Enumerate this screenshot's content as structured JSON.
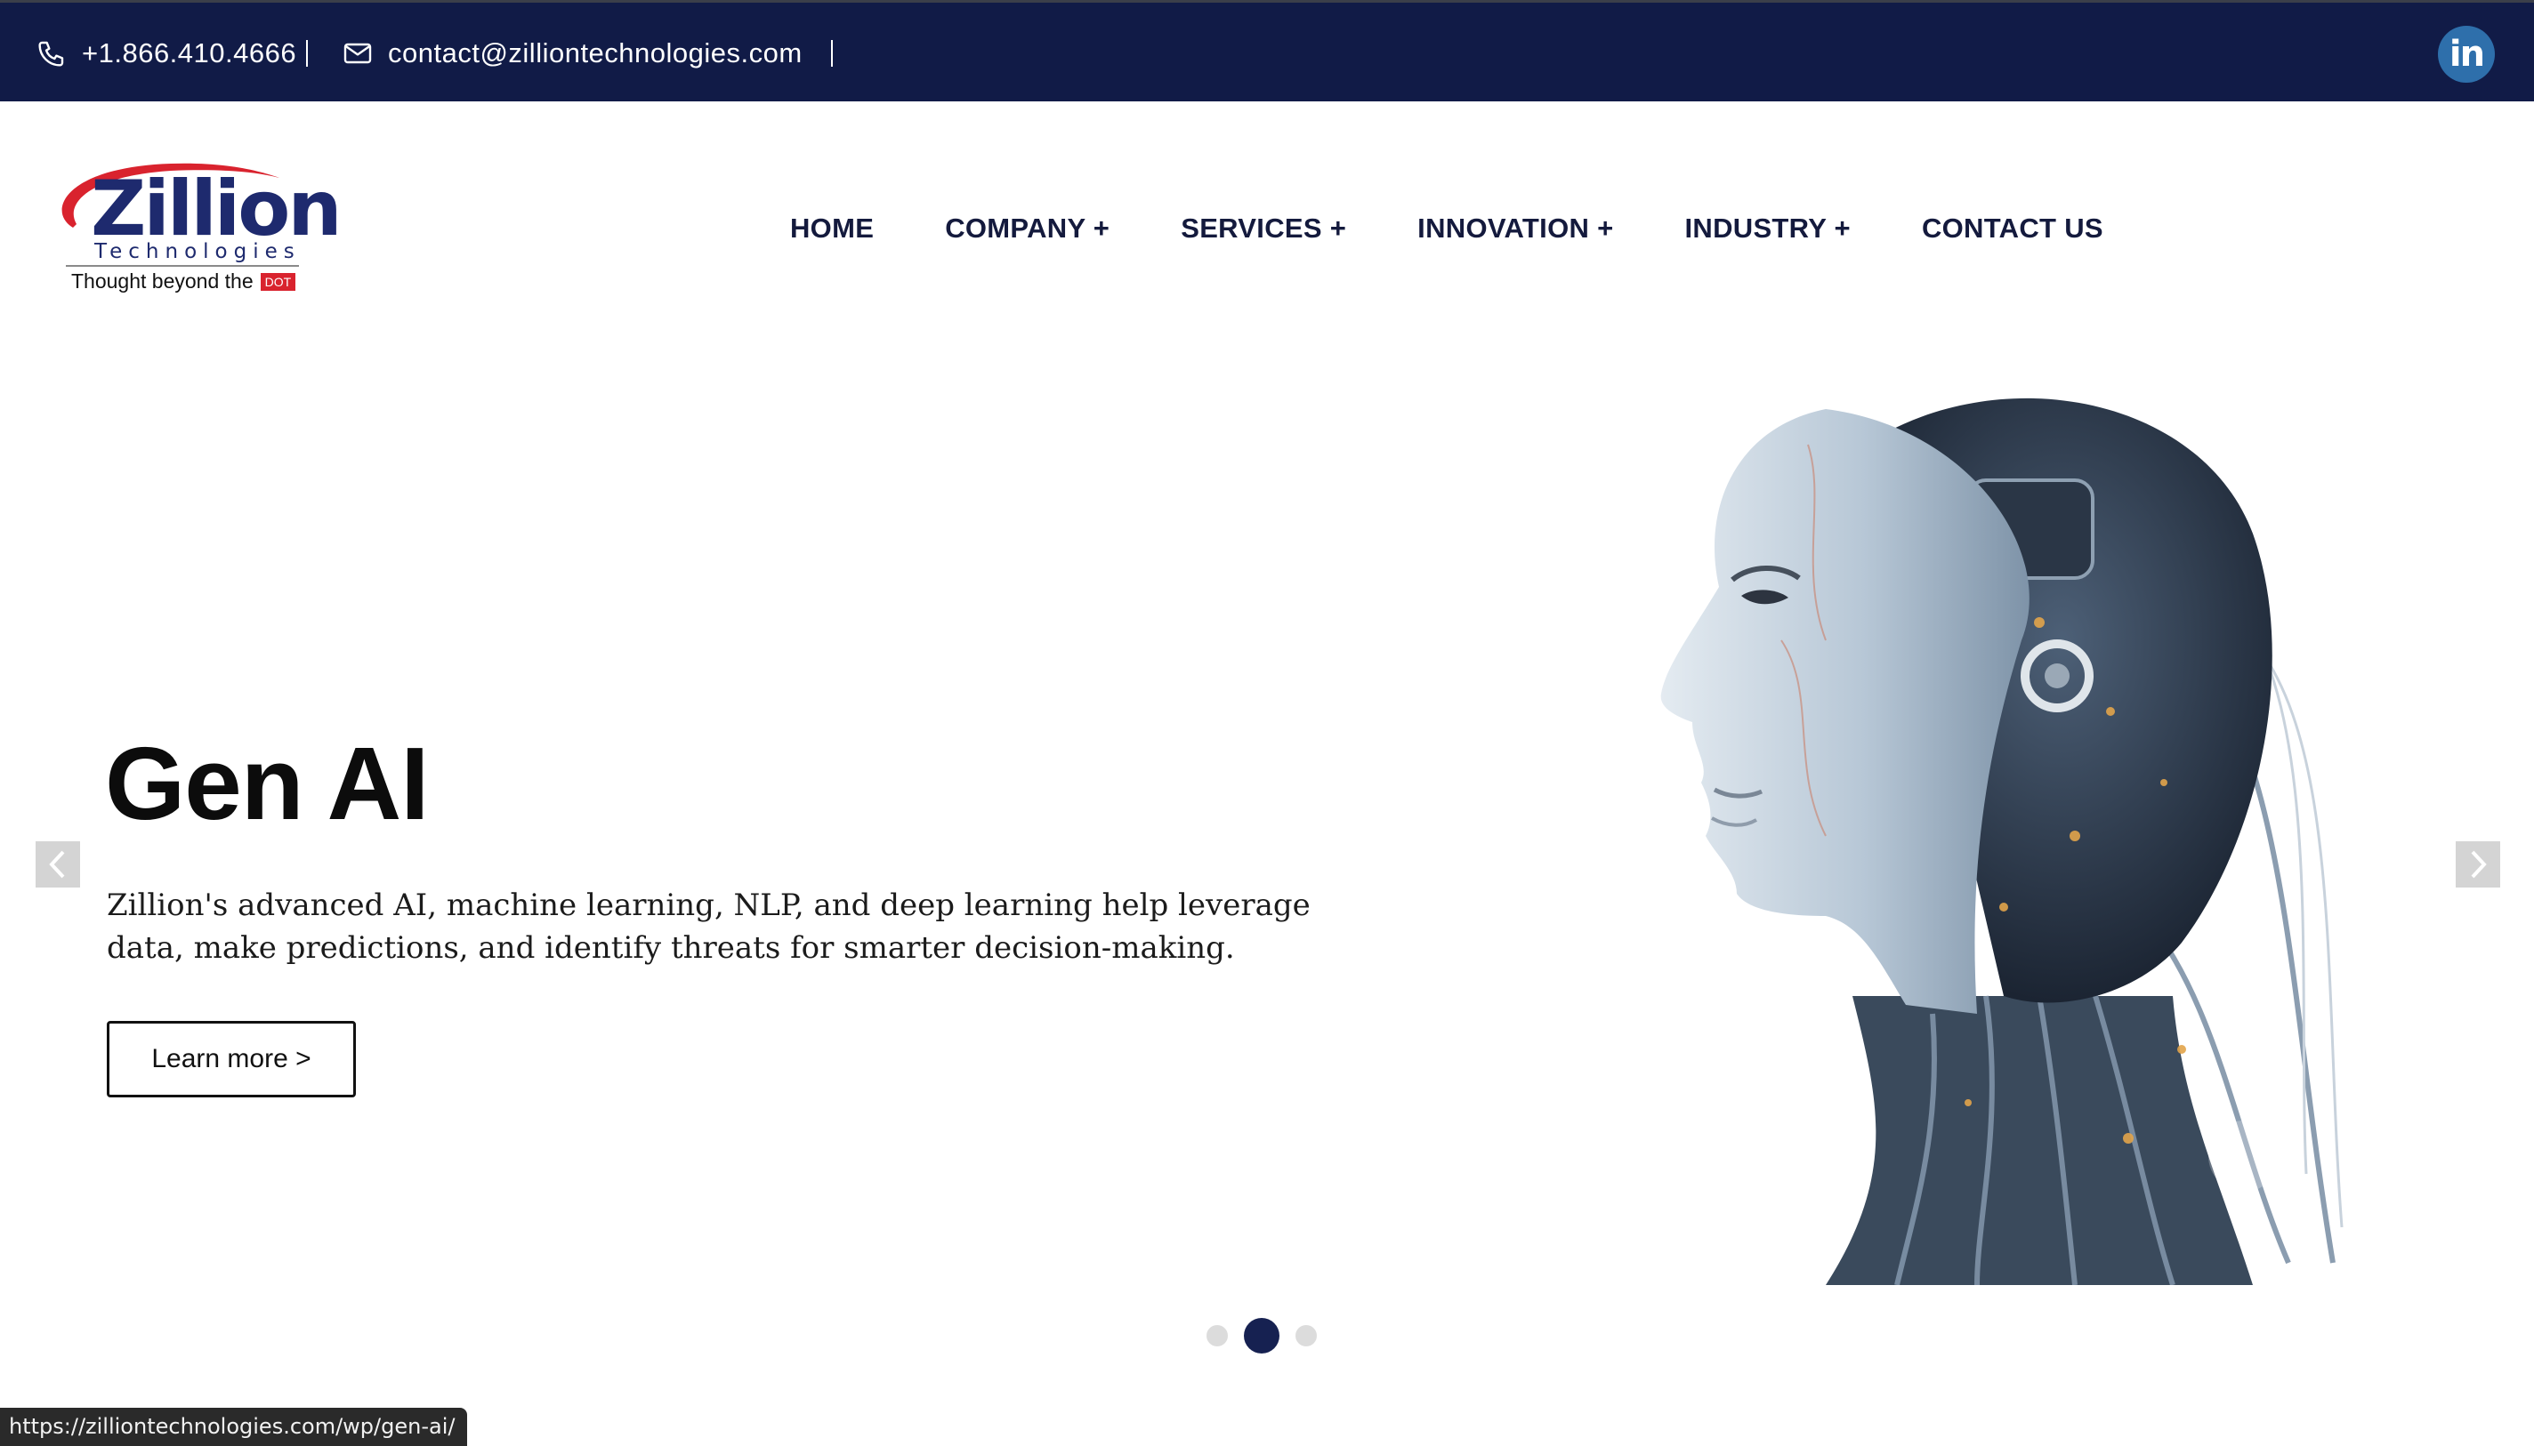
{
  "topbar": {
    "phone": "+1.866.410.4666",
    "email": "contact@zilliontechnologies.com",
    "social_icon": "linkedin-icon",
    "social_glyph": "in"
  },
  "brand": {
    "name": "Zillion",
    "sub": "Technologies",
    "tagline": "Thought beyond the",
    "tag_badge": "DOT"
  },
  "nav": {
    "items": [
      {
        "label": "HOME"
      },
      {
        "label": "COMPANY +"
      },
      {
        "label": "SERVICES +"
      },
      {
        "label": "INNOVATION +"
      },
      {
        "label": "INDUSTRY +"
      },
      {
        "label": "CONTACT US"
      }
    ]
  },
  "hero": {
    "title": "Gen AI",
    "description": "Zillion's advanced AI, machine learning, NLP, and deep learning help leverage data, make predictions, and identify threats for smarter decision-making.",
    "cta_label": "Learn more >"
  },
  "slider": {
    "slide_count": 3,
    "active_slide": 2
  },
  "status_bar": {
    "url": "https://zilliontechnologies.com/wp/gen-ai/"
  },
  "colors": {
    "topbar_bg": "#111b47",
    "brand_navy": "#1e2a6e",
    "accent_red": "#d9232e",
    "linkedin_blue": "#2e6fab",
    "active_dot": "#162151"
  }
}
